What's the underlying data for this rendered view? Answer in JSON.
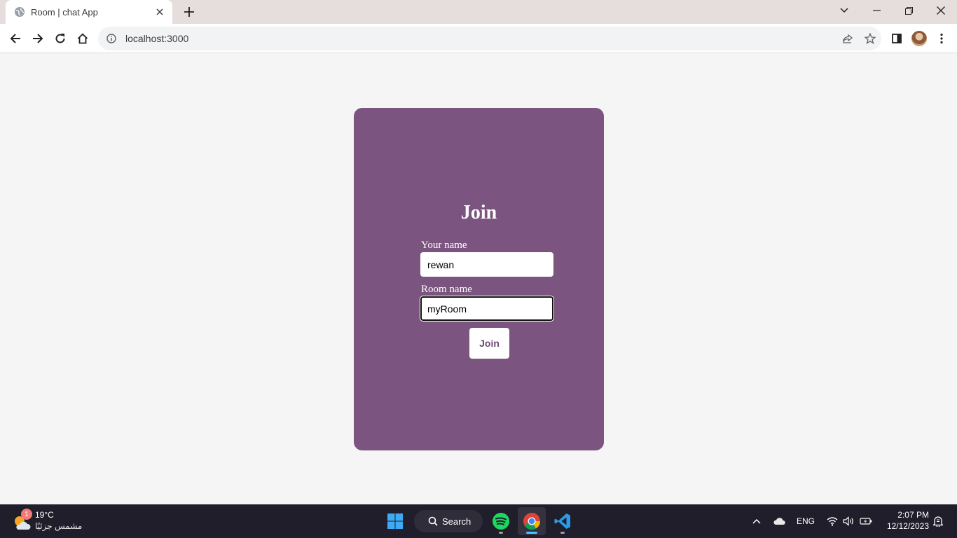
{
  "browser": {
    "tab_title": "Room | chat App",
    "url": "localhost:3000"
  },
  "page": {
    "heading": "Join",
    "name_label": "Your name",
    "name_value": "rewan",
    "room_label": "Room name",
    "room_value": "myRoom",
    "join_button": "Join",
    "colors": {
      "card": "#7b5580",
      "background": "#f4f5f4",
      "button_text": "#6b4a70"
    }
  },
  "taskbar": {
    "weather_temp": "19°C",
    "weather_desc": "مشمس جزئيًا",
    "weather_badge": "1",
    "search_label": "Search",
    "language": "ENG",
    "time": "2:07 PM",
    "date": "12/12/2023",
    "apps": [
      "windows-start",
      "spotify",
      "chrome",
      "vscode"
    ]
  }
}
